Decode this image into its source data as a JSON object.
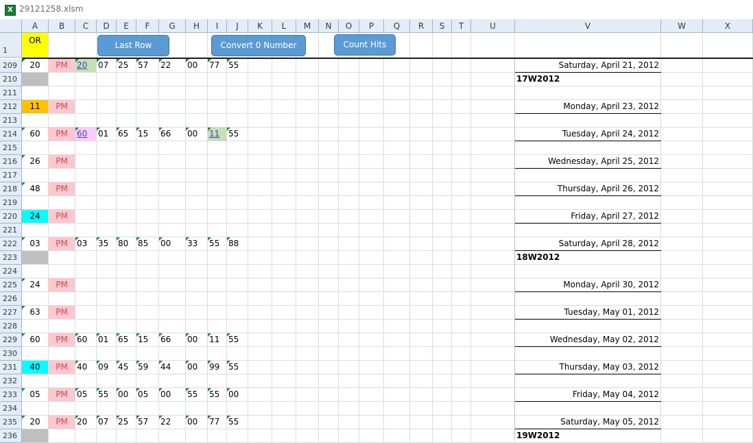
{
  "window": {
    "title": "29121258.xlsm",
    "app_icon": "excel-icon"
  },
  "columns": [
    "A",
    "B",
    "C",
    "D",
    "E",
    "F",
    "G",
    "H",
    "I",
    "J",
    "K",
    "L",
    "M",
    "N",
    "O",
    "P",
    "Q",
    "R",
    "S",
    "T",
    "U",
    "V",
    "W",
    "X"
  ],
  "header_row": {
    "number": "1",
    "a1_label": "OR"
  },
  "buttons": {
    "last_row": "Last Row",
    "convert": "Convert 0 Number",
    "count_hits": "Count Hits"
  },
  "colors": {
    "yellow": "#ffff00",
    "gray": "#bfbfbf",
    "orange": "#ffc000",
    "cyan": "#00ffff",
    "pink": "#ffc7ce",
    "pm_text": "#c0504d",
    "green_fill": "#c6e0b4",
    "magenta_fill": "#ffccff",
    "header_bg": "#e4ecf7",
    "button_blue": "#5b9bd5"
  },
  "rows": [
    {
      "num": "209",
      "a": "20",
      "b": "PM",
      "c": "20",
      "d": "07",
      "e": "25",
      "f": "57",
      "g": "22",
      "h": "00",
      "i": "77",
      "j": "55",
      "v": "Saturday, April 21, 2012"
    },
    {
      "num": "210",
      "a_fill": "gray",
      "v_week": "17W2012"
    },
    {
      "num": "211"
    },
    {
      "num": "212",
      "a": "11",
      "a_fill": "orange",
      "b": "PM",
      "v": "Monday, April 23, 2012"
    },
    {
      "num": "213"
    },
    {
      "num": "214",
      "a": "60",
      "b": "PM",
      "c": "60",
      "d": "01",
      "e": "65",
      "f": "15",
      "g": "66",
      "h": "00",
      "i": "11",
      "j": "55",
      "v": "Tuesday, April 24, 2012"
    },
    {
      "num": "215"
    },
    {
      "num": "216",
      "a": "26",
      "b": "PM",
      "v": "Wednesday, April 25, 2012"
    },
    {
      "num": "217"
    },
    {
      "num": "218",
      "a": "48",
      "b": "PM",
      "v": "Thursday, April 26, 2012"
    },
    {
      "num": "219"
    },
    {
      "num": "220",
      "a": "24",
      "a_fill": "cyan",
      "b": "PM",
      "v": "Friday, April 27, 2012"
    },
    {
      "num": "221"
    },
    {
      "num": "222",
      "a": "03",
      "b": "PM",
      "c": "03",
      "d": "35",
      "e": "80",
      "f": "85",
      "g": "00",
      "h": "33",
      "i": "55",
      "j": "88",
      "v": "Saturday, April 28, 2012"
    },
    {
      "num": "223",
      "a_fill": "gray",
      "v_week": "18W2012"
    },
    {
      "num": "224"
    },
    {
      "num": "225",
      "a": "24",
      "b": "PM",
      "v": "Monday, April 30, 2012"
    },
    {
      "num": "226"
    },
    {
      "num": "227",
      "a": "63",
      "b": "PM",
      "v": "Tuesday, May 01, 2012"
    },
    {
      "num": "228"
    },
    {
      "num": "229",
      "a": "60",
      "b": "PM",
      "c": "60",
      "d": "01",
      "e": "65",
      "f": "15",
      "g": "66",
      "h": "00",
      "i": "11",
      "j": "55",
      "v": "Wednesday, May 02, 2012"
    },
    {
      "num": "230"
    },
    {
      "num": "231",
      "a": "40",
      "a_fill": "cyan",
      "b": "PM",
      "c": "40",
      "d": "09",
      "e": "45",
      "f": "59",
      "g": "44",
      "h": "00",
      "i": "99",
      "j": "55",
      "v": "Thursday, May 03, 2012"
    },
    {
      "num": "232"
    },
    {
      "num": "233",
      "a": "05",
      "b": "PM",
      "c": "05",
      "d": "55",
      "e": "00",
      "f": "05",
      "g": "00",
      "h": "55",
      "i": "55",
      "j": "00",
      "v": "Friday, May 04, 2012"
    },
    {
      "num": "234"
    },
    {
      "num": "235",
      "a": "20",
      "b": "PM",
      "c": "20",
      "d": "07",
      "e": "25",
      "f": "57",
      "g": "22",
      "h": "00",
      "i": "77",
      "j": "55",
      "v": "Saturday, May 05, 2012"
    },
    {
      "num": "236",
      "a_fill": "gray",
      "v_week": "19W2012"
    }
  ]
}
